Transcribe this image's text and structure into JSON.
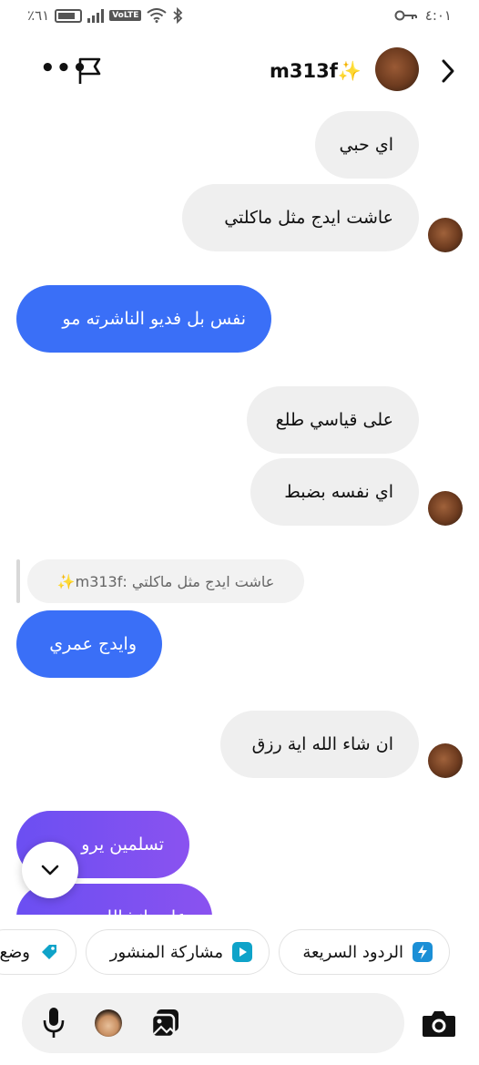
{
  "status_bar": {
    "battery": "٪٦١",
    "volte": "VoLTE",
    "time": "٤:٠١"
  },
  "header": {
    "username": "m313f✨",
    "icons": [
      "more-dots-icon",
      "flag-icon",
      "back-chevron-icon"
    ]
  },
  "messages": [
    {
      "side": "in",
      "text": "اي حبي"
    },
    {
      "side": "in",
      "text": "عاشت ايدج مثل ماكلتي"
    },
    {
      "side": "out",
      "text": "نفس بل فديو الناشرته مو"
    },
    {
      "side": "in",
      "text": "على قياسي طلع"
    },
    {
      "side": "in",
      "text": "اي نفسه بضبط"
    },
    {
      "side": "reply",
      "text": "عاشت ايدج مثل ماكلتي :m313f✨"
    },
    {
      "side": "out",
      "text": "وايدج عمري"
    },
    {
      "side": "in",
      "text": "ان شاء الله اية رزق"
    },
    {
      "side": "out",
      "text": "تسلمين يرو"
    },
    {
      "side": "out",
      "text": "عاوه انشالله يرب"
    }
  ],
  "quick_actions": [
    {
      "label": "الردود السريعة",
      "icon": "lightning-icon"
    },
    {
      "label": "مشاركة المنشور",
      "icon": "play-icon"
    },
    {
      "label": "وضع",
      "icon": "tag-icon"
    }
  ],
  "composer": {
    "icons": [
      "camera-icon",
      "gallery-icon",
      "sticker-face-icon",
      "microphone-icon"
    ]
  },
  "colors": {
    "outgoing": "#3a6ff7",
    "outgoing_gradient": "#7a50f1",
    "incoming": "#efefef"
  }
}
